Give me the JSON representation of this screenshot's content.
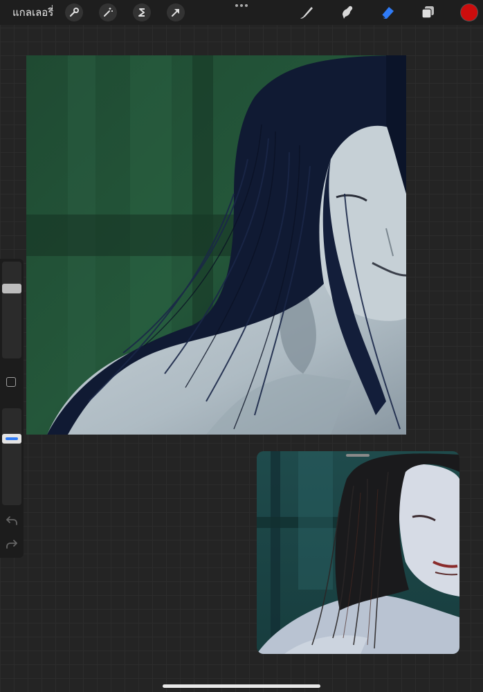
{
  "toolbar": {
    "gallery_label": "แกลเลอรี่",
    "left_tools": [
      {
        "name": "actions",
        "icon": "wrench-icon"
      },
      {
        "name": "adjustments",
        "icon": "magic-wand-icon"
      },
      {
        "name": "selection",
        "icon": "selection-s-icon"
      },
      {
        "name": "transform",
        "icon": "arrow-cursor-icon"
      }
    ],
    "right_tools": [
      {
        "name": "brush",
        "icon": "brush-icon",
        "active": false
      },
      {
        "name": "smudge",
        "icon": "smudge-icon",
        "active": false
      },
      {
        "name": "eraser",
        "icon": "eraser-icon",
        "active": true
      },
      {
        "name": "layers",
        "icon": "layers-icon",
        "active": false
      }
    ],
    "current_color": "#cc0d0d",
    "accent_color": "#2f7bf6"
  },
  "sidebar": {
    "brush_size_level": 0.9,
    "brush_opacity_level": 0.7,
    "modify_icon": "square-icon",
    "undo_icon": "undo-icon",
    "redo_icon": "redo-icon"
  },
  "canvas": {
    "artwork": "painted-portrait"
  },
  "reference": {
    "artwork": "reference-portrait"
  }
}
